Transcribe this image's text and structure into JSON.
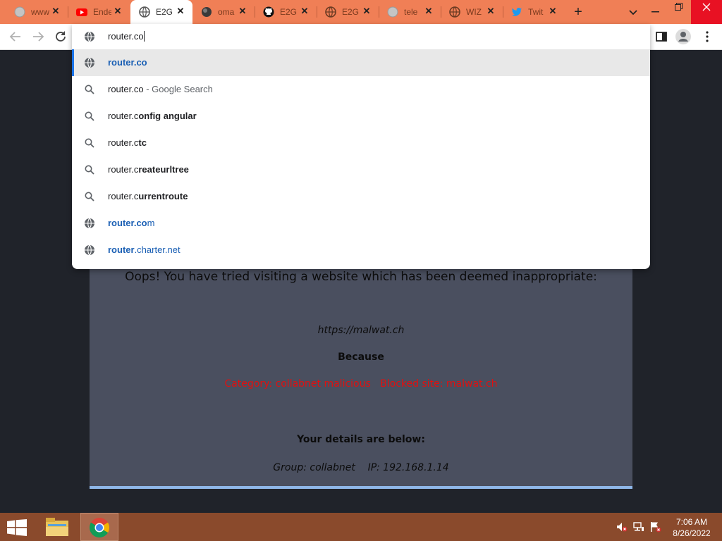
{
  "tabs": [
    {
      "title": "www.",
      "icon": "globe-icon"
    },
    {
      "title": "Ende",
      "icon": "youtube-icon"
    },
    {
      "title": "E2G",
      "icon": "globe-icon",
      "active": true
    },
    {
      "title": "oma",
      "icon": "globe-dark-icon"
    },
    {
      "title": "E2G",
      "icon": "github-icon"
    },
    {
      "title": "E2G",
      "icon": "globe-icon"
    },
    {
      "title": "tele",
      "icon": "globe-icon"
    },
    {
      "title": "WIZ",
      "icon": "globe-icon"
    },
    {
      "title": "Twit",
      "icon": "twitter-icon"
    }
  ],
  "omnibox": {
    "input_value": "router.co",
    "suggestions": [
      {
        "type": "url",
        "selected": true,
        "parts": [
          {
            "text": "router.co",
            "style": "url-bold"
          }
        ]
      },
      {
        "type": "search",
        "parts": [
          {
            "text": "router.co",
            "style": "plain"
          },
          {
            "text": " - Google Search",
            "style": "desc"
          }
        ]
      },
      {
        "type": "search",
        "parts": [
          {
            "text": "router.c",
            "style": "plain"
          },
          {
            "text": "onfig angular",
            "style": "bold"
          }
        ]
      },
      {
        "type": "search",
        "parts": [
          {
            "text": "router.c",
            "style": "plain"
          },
          {
            "text": "tc",
            "style": "bold"
          }
        ]
      },
      {
        "type": "search",
        "parts": [
          {
            "text": "router.c",
            "style": "plain"
          },
          {
            "text": "reateurltree",
            "style": "bold"
          }
        ]
      },
      {
        "type": "search",
        "parts": [
          {
            "text": "router.c",
            "style": "plain"
          },
          {
            "text": "urrentroute",
            "style": "bold"
          }
        ]
      },
      {
        "type": "url",
        "parts": [
          {
            "text": "router.co",
            "style": "url-bold"
          },
          {
            "text": "m",
            "style": "url"
          }
        ]
      },
      {
        "type": "url",
        "parts": [
          {
            "text": "router",
            "style": "url-bold"
          },
          {
            "text": ".charter.net",
            "style": "url"
          }
        ]
      }
    ]
  },
  "page": {
    "heading": "Oops! You have tried visiting a website which has been deemed inappropriate:",
    "blocked_url": "https://malwat.ch",
    "because_label": "Because",
    "category_line": "Category: collabnet malicious   Blocked site: malwat.ch",
    "details_label": "Your details are below:",
    "group_line": "Group: collabnet    IP: 192.168.1.14"
  },
  "taskbar": {
    "time": "7:06 AM",
    "date": "8/26/2022"
  },
  "colors": {
    "tabstrip": "#f07f56",
    "page_panel": "#4a4f5f",
    "category_text": "#e01010",
    "selected_accent": "#1a73e8",
    "taskbar": "#8a4a2c"
  }
}
